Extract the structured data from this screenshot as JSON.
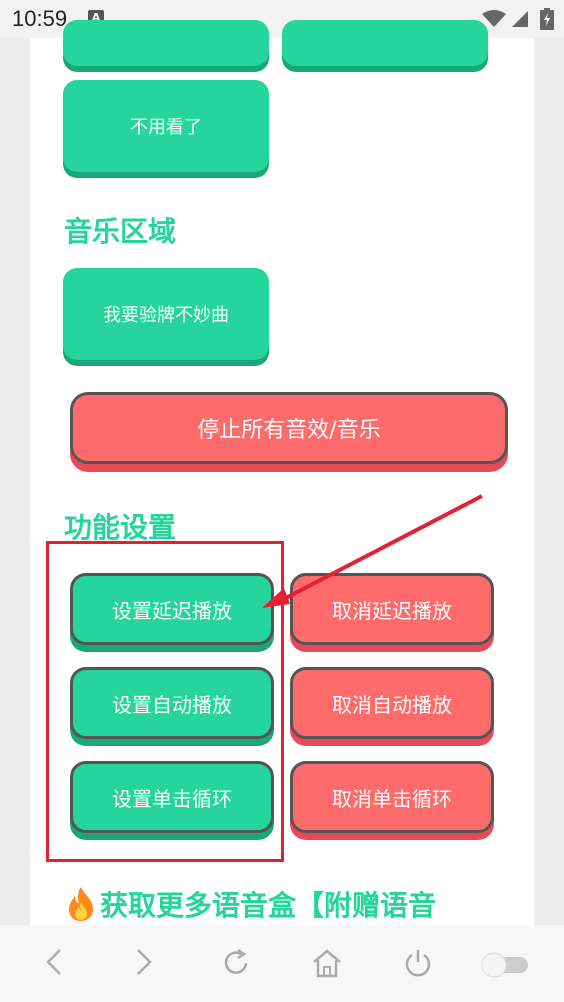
{
  "status_bar": {
    "time": "10:59",
    "notification_icon": "a-notification-icon",
    "wifi_icon": "wifi-icon",
    "signal_icon": "signal-icon",
    "battery_icon": "battery-charging-icon"
  },
  "sounds": {
    "partial_top_left": "",
    "partial_top_right": "",
    "no_need": "不用看了"
  },
  "music_section": {
    "title": "音乐区域",
    "items": [
      "我要验牌不妙曲"
    ]
  },
  "stop_all": "停止所有音效/音乐",
  "settings_section": {
    "title": "功能设置",
    "set_delay": "设置延迟播放",
    "cancel_delay": "取消延迟播放",
    "set_auto": "设置自动播放",
    "cancel_auto": "取消自动播放",
    "set_loop": "设置单击循环",
    "cancel_loop": "取消单击循环"
  },
  "promo": {
    "icon": "fire-icon",
    "text": "获取更多语音盒【附赠语音"
  },
  "bottom_nav": {
    "back": "chevron-left-icon",
    "forward": "chevron-right-icon",
    "refresh": "refresh-icon",
    "home": "home-icon",
    "power": "power-icon",
    "toggle": "toggle-icon"
  },
  "colors": {
    "green": "#25d59b",
    "red": "#ff6b6b",
    "annotation": "#e52030"
  }
}
